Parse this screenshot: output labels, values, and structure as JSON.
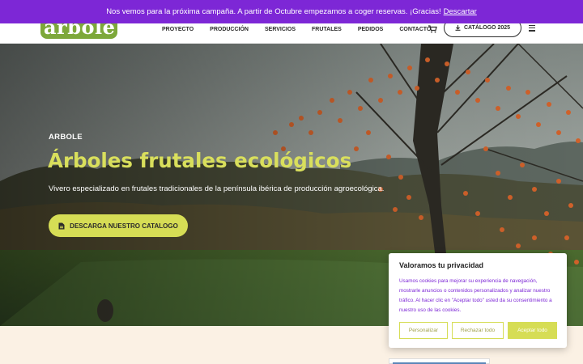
{
  "notice": {
    "text": "Nos vemos para la próxima campaña. A partir de Octubre empezamos a coger reservas. ¡Gracias!",
    "dismiss_label": "Descartar"
  },
  "header": {
    "logo_text": "arbole",
    "nav": [
      "PROYECTO",
      "PRODUCCIÓN",
      "SERVICIOS",
      "FRUTALES",
      "PEDIDOS",
      "CONTACTO"
    ],
    "cart_icon": "cart-icon",
    "catalog_button": "CATÁLOGO 2025",
    "menu_icon": "hamburger-icon"
  },
  "hero": {
    "eyebrow": "ARBOLE",
    "title": "Árboles frutales ecológicos",
    "subtitle": "Vivero especializado en frutales tradicionales de la península ibérica de producción agroecológica.",
    "button_label": "DESCARGA NUESTRO CATALOGO"
  },
  "cookie": {
    "title": "Valoramos tu privacidad",
    "text": "Usamos cookies para mejorar su experiencia de navegación, mostrarle anuncios o contenidos personalizados y analizar nuestro tráfico. Al hacer clic en \"Aceptar todo\" usted da su consentimiento a nuestro uso de las cookies.",
    "customize_label": "Personalizar",
    "reject_label": "Rechazar todo",
    "accept_label": "Aceptar todo"
  },
  "colors": {
    "notice_bg": "#7d27d6",
    "accent": "#d6dd55",
    "logo_green": "#7da83a"
  }
}
